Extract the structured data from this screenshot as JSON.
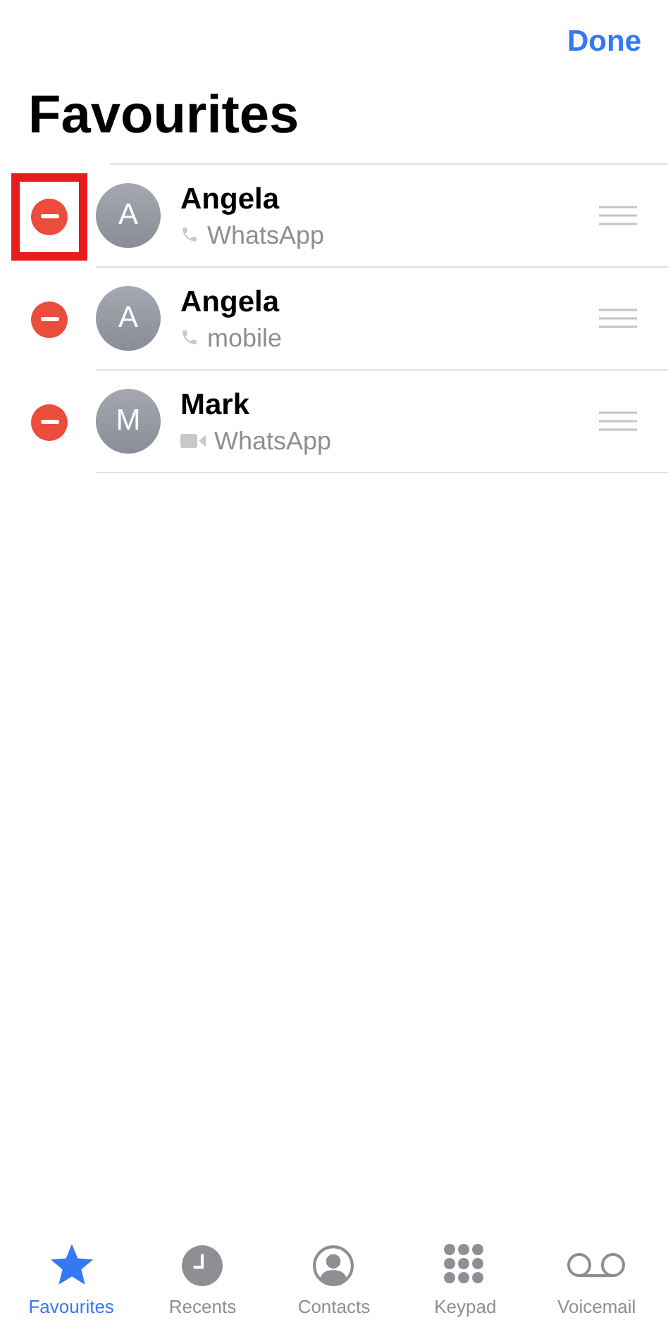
{
  "nav": {
    "done": "Done"
  },
  "title": "Favourites",
  "favourites": [
    {
      "initial": "A",
      "name": "Angela",
      "kind": "phone",
      "label": "WhatsApp",
      "highlighted": true
    },
    {
      "initial": "A",
      "name": "Angela",
      "kind": "phone",
      "label": "mobile",
      "highlighted": false
    },
    {
      "initial": "M",
      "name": "Mark",
      "kind": "video",
      "label": "WhatsApp",
      "highlighted": false
    }
  ],
  "tab_bar": [
    {
      "kind": "star",
      "label": "Favourites",
      "selected": true
    },
    {
      "kind": "clock",
      "label": "Recents",
      "selected": false
    },
    {
      "kind": "person",
      "label": "Contacts",
      "selected": false
    },
    {
      "kind": "keypad",
      "label": "Keypad",
      "selected": false
    },
    {
      "kind": "voicemail",
      "label": "Voicemail",
      "selected": false
    }
  ]
}
